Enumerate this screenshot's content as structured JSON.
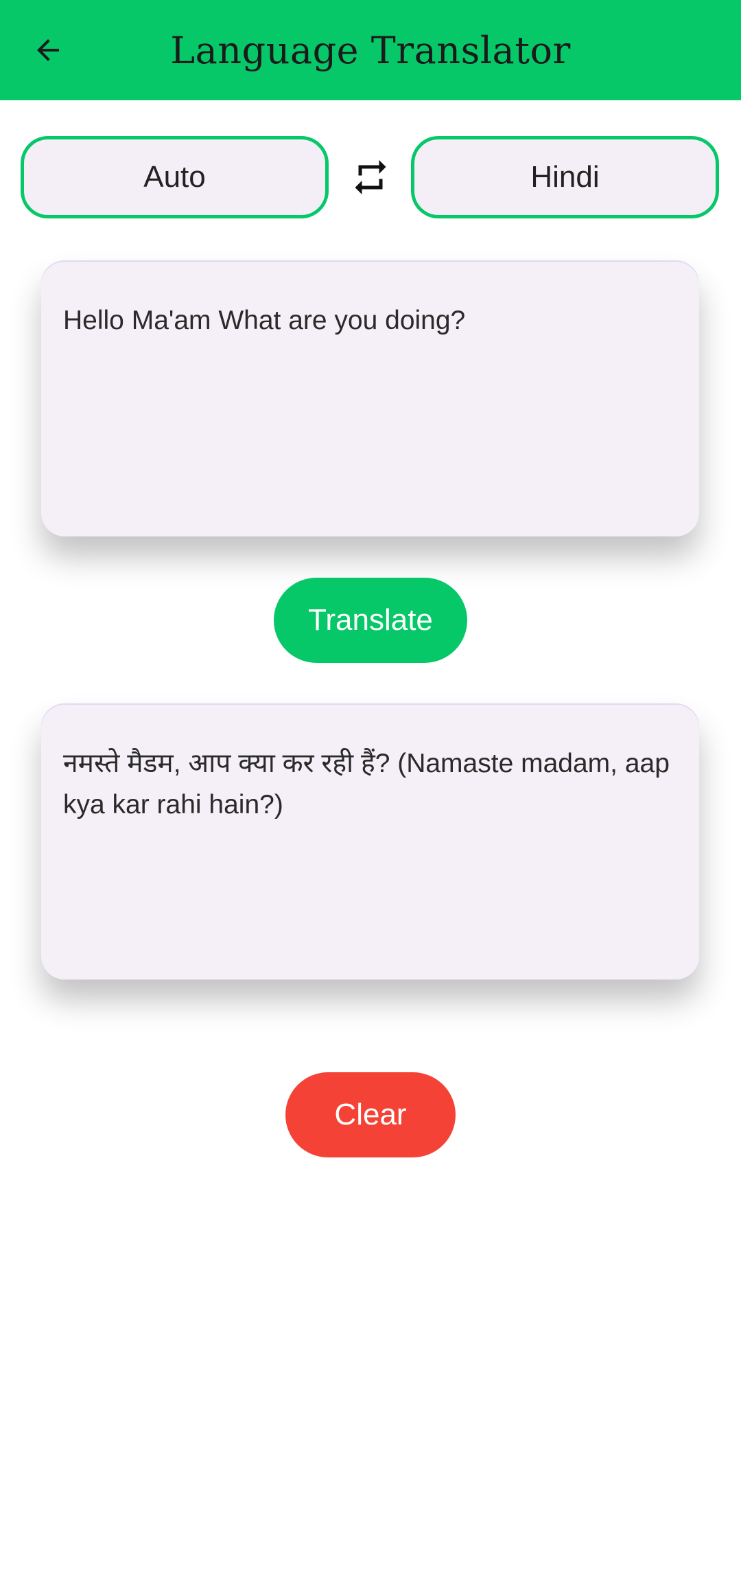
{
  "app_bar": {
    "title": "Language Translator",
    "back_icon": "arrow-left-icon",
    "background": "#07c868"
  },
  "languages": {
    "source": "Auto",
    "target": "Hindi",
    "swap_icon": "swap-arrows-icon"
  },
  "input": {
    "text": "Hello Ma'am What are you doing?"
  },
  "actions": {
    "translate_label": "Translate",
    "translate_color": "#07c868",
    "clear_label": "Clear",
    "clear_color": "#f44336"
  },
  "output": {
    "text": "नमस्ते मैडम, आप क्या कर रही हैं? (Namaste madam, aap kya kar rahi hain?)"
  },
  "colors": {
    "card_background": "#f5eff7",
    "accent": "#07c868"
  }
}
